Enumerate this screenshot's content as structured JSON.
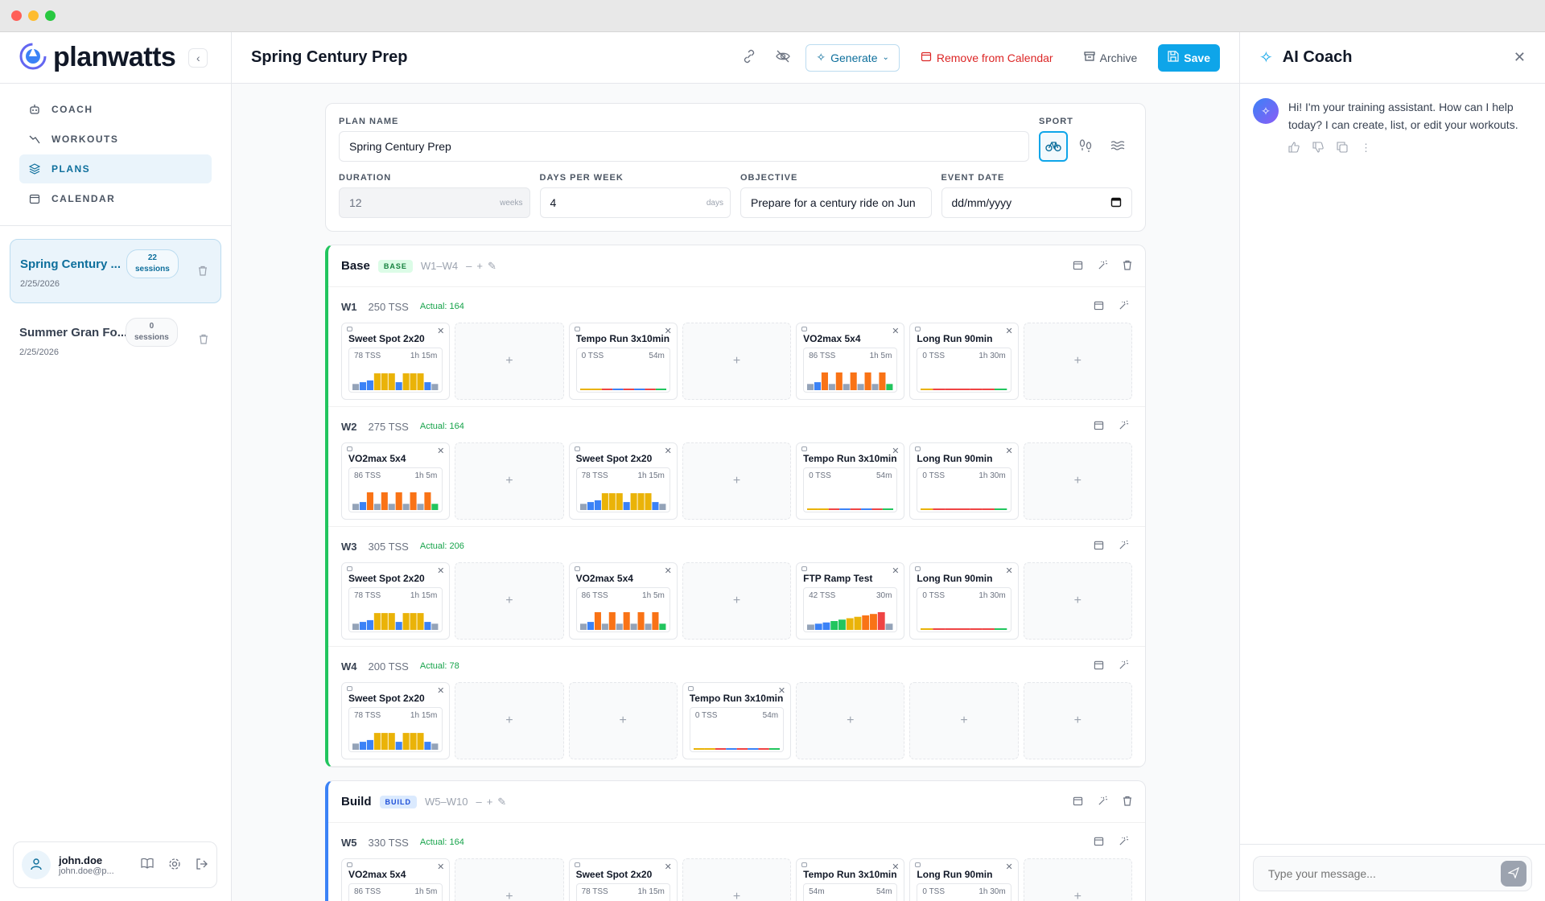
{
  "window": {
    "dots": [
      "#ff5f57",
      "#febc2e",
      "#28c840"
    ]
  },
  "brand": {
    "name": "planwatts"
  },
  "nav": [
    {
      "label": "COACH",
      "icon": "robot-icon",
      "active": false
    },
    {
      "label": "WORKOUTS",
      "icon": "activity-icon",
      "active": false
    },
    {
      "label": "PLANS",
      "icon": "layers-icon",
      "active": true
    },
    {
      "label": "CALENDAR",
      "icon": "calendar-icon",
      "active": false
    }
  ],
  "plans": [
    {
      "name": "Spring Century ...",
      "sessions": "22",
      "sessions_label": "sessions",
      "date": "2/25/2026",
      "active": true
    },
    {
      "name": "Summer Gran Fo...",
      "sessions": "0",
      "sessions_label": "sessions",
      "date": "2/25/2026",
      "active": false
    }
  ],
  "user": {
    "name": "john.doe",
    "email": "john.doe@p..."
  },
  "topbar": {
    "title": "Spring Century Prep",
    "generate": "Generate",
    "remove": "Remove from Calendar",
    "archive": "Archive",
    "save": "Save"
  },
  "form": {
    "plan_name_label": "PLAN NAME",
    "plan_name": "Spring Century Prep",
    "sport_label": "SPORT",
    "duration_label": "DURATION",
    "duration": "12",
    "duration_unit": "weeks",
    "days_label": "DAYS PER WEEK",
    "days": "4",
    "days_unit": "days",
    "objective_label": "OBJECTIVE",
    "objective": "Prepare for a century ride on Jun",
    "event_label": "EVENT DATE",
    "event_placeholder": "dd/mm/yyyy"
  },
  "phases": [
    {
      "name": "Base",
      "tag": "BASE",
      "range": "W1–W4",
      "kind": "base",
      "weeks": [
        {
          "label": "W1",
          "tss": "250 TSS",
          "actual": "Actual: 164",
          "days": [
            {
              "name": "Sweet Spot 2x20",
              "tss": "78 TSS",
              "dur": "1h 15m",
              "type": "ss"
            },
            null,
            {
              "name": "Tempo Run 3x10min",
              "tss": "0 TSS",
              "dur": "54m",
              "type": "run"
            },
            null,
            {
              "name": "VO2max 5x4",
              "tss": "86 TSS",
              "dur": "1h 5m",
              "type": "vo2"
            },
            {
              "name": "Long Run 90min",
              "tss": "0 TSS",
              "dur": "1h 30m",
              "type": "long"
            },
            null
          ]
        },
        {
          "label": "W2",
          "tss": "275 TSS",
          "actual": "Actual: 164",
          "days": [
            {
              "name": "VO2max 5x4",
              "tss": "86 TSS",
              "dur": "1h 5m",
              "type": "vo2"
            },
            null,
            {
              "name": "Sweet Spot 2x20",
              "tss": "78 TSS",
              "dur": "1h 15m",
              "type": "ss"
            },
            null,
            {
              "name": "Tempo Run 3x10min",
              "tss": "0 TSS",
              "dur": "54m",
              "type": "run"
            },
            {
              "name": "Long Run 90min",
              "tss": "0 TSS",
              "dur": "1h 30m",
              "type": "long"
            },
            null
          ]
        },
        {
          "label": "W3",
          "tss": "305 TSS",
          "actual": "Actual: 206",
          "days": [
            {
              "name": "Sweet Spot 2x20",
              "tss": "78 TSS",
              "dur": "1h 15m",
              "type": "ss"
            },
            null,
            {
              "name": "VO2max 5x4",
              "tss": "86 TSS",
              "dur": "1h 5m",
              "type": "vo2"
            },
            null,
            {
              "name": "FTP Ramp Test",
              "tss": "42 TSS",
              "dur": "30m",
              "type": "ramp"
            },
            {
              "name": "Long Run 90min",
              "tss": "0 TSS",
              "dur": "1h 30m",
              "type": "long"
            },
            null
          ]
        },
        {
          "label": "W4",
          "tss": "200 TSS",
          "actual": "Actual: 78",
          "days": [
            {
              "name": "Sweet Spot 2x20",
              "tss": "78 TSS",
              "dur": "1h 15m",
              "type": "ss"
            },
            null,
            null,
            {
              "name": "Tempo Run 3x10min",
              "tss": "0 TSS",
              "dur": "54m",
              "type": "run"
            },
            null,
            null,
            null
          ]
        }
      ]
    },
    {
      "name": "Build",
      "tag": "BUILD",
      "range": "W5–W10",
      "kind": "build",
      "weeks": [
        {
          "label": "W5",
          "tss": "330 TSS",
          "actual": "Actual: 164",
          "days": [
            {
              "name": "VO2max 5x4",
              "tss": "86 TSS",
              "dur": "1h 5m",
              "type": "vo2"
            },
            null,
            {
              "name": "Sweet Spot 2x20",
              "tss": "78 TSS",
              "dur": "1h 15m",
              "type": "ss"
            },
            null,
            {
              "name": "Tempo Run 3x10min",
              "tss": "54m",
              "dur": "54m",
              "type": "run"
            },
            {
              "name": "Long Run 90min",
              "tss": "0 TSS",
              "dur": "1h 30m",
              "type": "long"
            },
            null
          ]
        }
      ]
    }
  ],
  "coach": {
    "title": "AI Coach",
    "message": "Hi! I'm your training assistant. How can I help today? I can create, list, or edit your workouts.",
    "input_placeholder": "Type your message..."
  },
  "colors": {
    "accent": "#0ea5e9",
    "base": "#22c55e",
    "build": "#3b82f6",
    "danger": "#dc2626"
  }
}
